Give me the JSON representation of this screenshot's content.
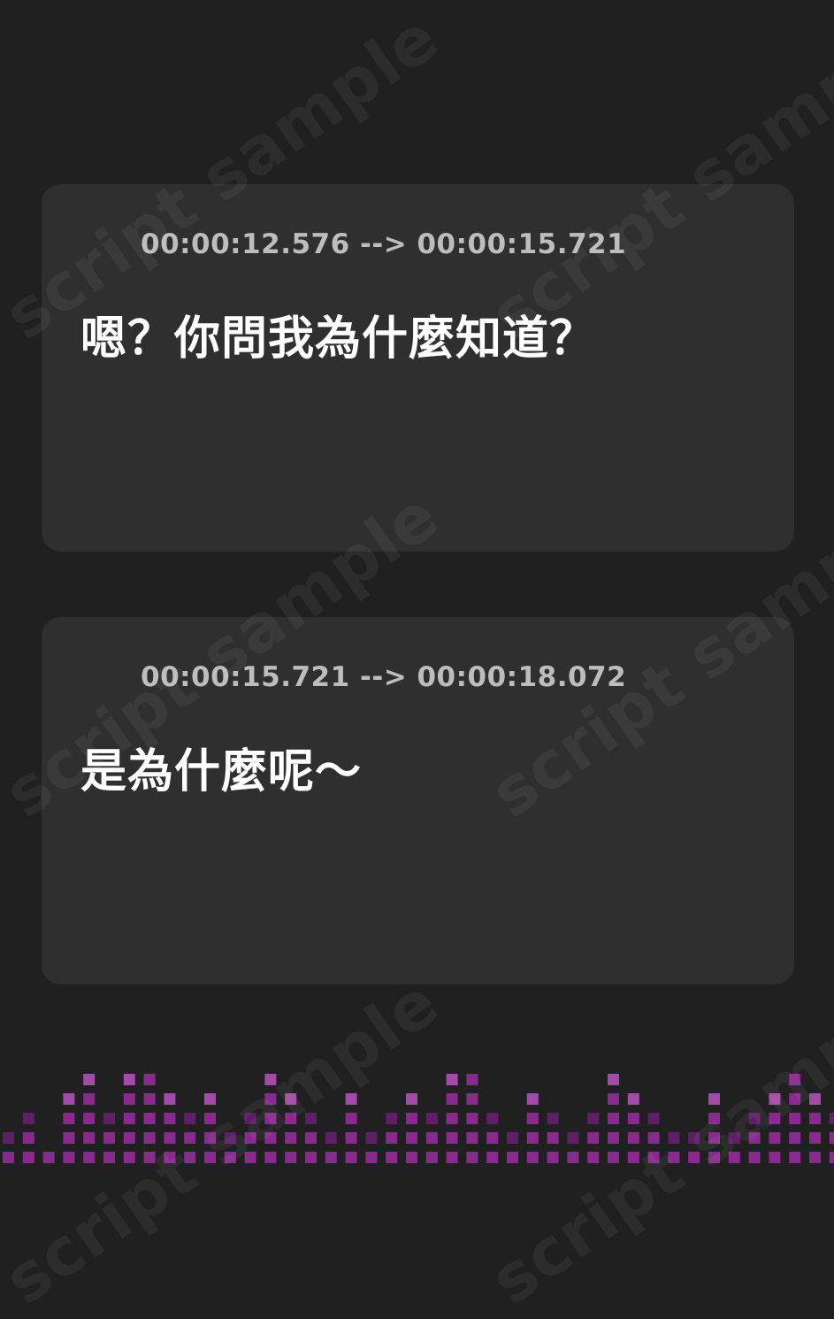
{
  "watermark": {
    "text": "script sample"
  },
  "cues": [
    {
      "timestamp": "00:00:12.576 --> 00:00:15.721",
      "text": "嗯？你問我為什麼知道？"
    },
    {
      "timestamp": "00:00:15.721 --> 00:00:18.072",
      "text": "是為什麼呢～"
    }
  ],
  "colors": {
    "background": "#202020",
    "card": "#2f2f2f",
    "timestamp": "#bdbdbd",
    "text": "#ffffff",
    "accent_light": "#e070f0",
    "accent_dark": "#a020c0",
    "equalizer_bright": "#8a2a8e",
    "equalizer_dim": "#5e1f66",
    "equalizer_top": "#a44aa8"
  },
  "icons": {
    "cue_icon": "audio-waveform-icon"
  },
  "equalizer_levels": [
    1,
    2,
    0,
    3,
    4,
    2,
    4,
    5,
    3,
    2,
    3,
    1,
    2,
    4,
    3,
    2,
    1,
    3,
    1,
    2,
    3,
    2,
    4,
    5,
    2,
    1,
    3,
    2,
    1,
    2,
    4,
    3,
    2,
    1,
    1,
    3,
    1,
    2,
    3,
    5,
    3,
    2,
    4,
    2,
    1,
    1
  ]
}
